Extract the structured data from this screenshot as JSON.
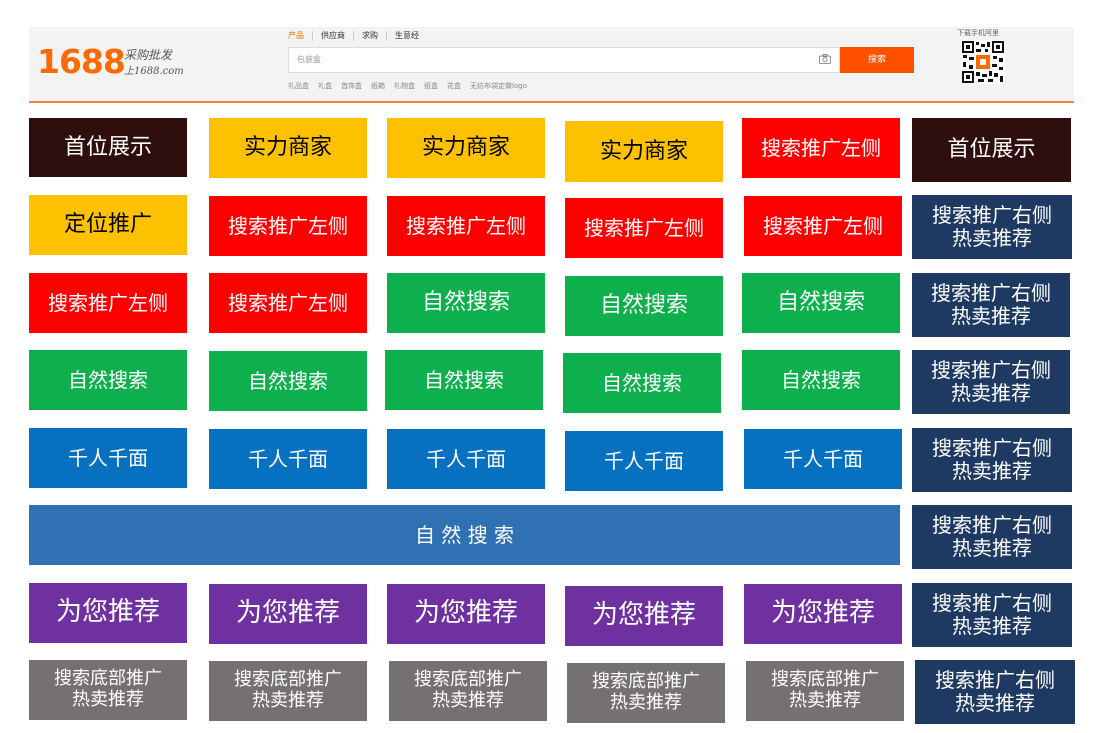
{
  "header": {
    "logo": "1688",
    "slogan_line1": "采购批发",
    "slogan_line2": "上1688.com",
    "tabs": [
      {
        "label": "产品",
        "active": true
      },
      {
        "label": "供应商",
        "active": false
      },
      {
        "label": "求购",
        "active": false
      },
      {
        "label": "生意经",
        "active": false
      }
    ],
    "search_value": "包装盒",
    "search_button": "搜索",
    "hotwords": [
      "礼品盒",
      "礼盒",
      "首饰盒",
      "纸箱",
      "礼物盒",
      "纸盒",
      "花盒",
      "无纺布袋定做logo"
    ],
    "qr_label": "下载手机阿里"
  },
  "grid": {
    "row1": [
      "首位展示",
      "实力商家",
      "实力商家",
      "实力商家",
      "搜索推广左侧",
      "首位展示"
    ],
    "row2": [
      "定位推广",
      "搜索推广左侧",
      "搜索推广左侧",
      "搜索推广左侧",
      "搜索推广左侧",
      "搜索推广右侧\n热卖推荐"
    ],
    "row3": [
      "搜索推广左侧",
      "搜索推广左侧",
      "自然搜索",
      "自然搜索",
      "自然搜索",
      "搜索推广右侧\n热卖推荐"
    ],
    "row4": [
      "自然搜索",
      "自然搜索",
      "自然搜索",
      "自然搜索",
      "自然搜索",
      "搜索推广右侧\n热卖推荐"
    ],
    "row5": [
      "千人千面",
      "千人千面",
      "千人千面",
      "千人千面",
      "千人千面",
      "搜索推广右侧\n热卖推荐"
    ],
    "row6": [
      "自 然 搜 索",
      "搜索推广右侧\n热卖推荐"
    ],
    "row7": [
      "为您推荐",
      "为您推荐",
      "为您推荐",
      "为您推荐",
      "为您推荐",
      "搜索推广右侧\n热卖推荐"
    ],
    "row8": [
      "搜索底部推广\n热卖推荐",
      "搜索底部推广\n热卖推荐",
      "搜索底部推广\n热卖推荐",
      "搜索底部推广\n热卖推荐",
      "搜索底部推广\n热卖推荐",
      "搜索推广右侧\n热卖推荐"
    ]
  },
  "colors": {
    "brand_orange": "#ff6a00",
    "search_button": "#ff5000",
    "dark": "#2f0e0e",
    "yellow": "#fdc100",
    "red": "#fe0000",
    "green": "#0eb04d",
    "blue": "#0771c1",
    "navy": "#1e3962",
    "steel": "#3071b4",
    "purple": "#6f30a0",
    "grey": "#767171"
  }
}
